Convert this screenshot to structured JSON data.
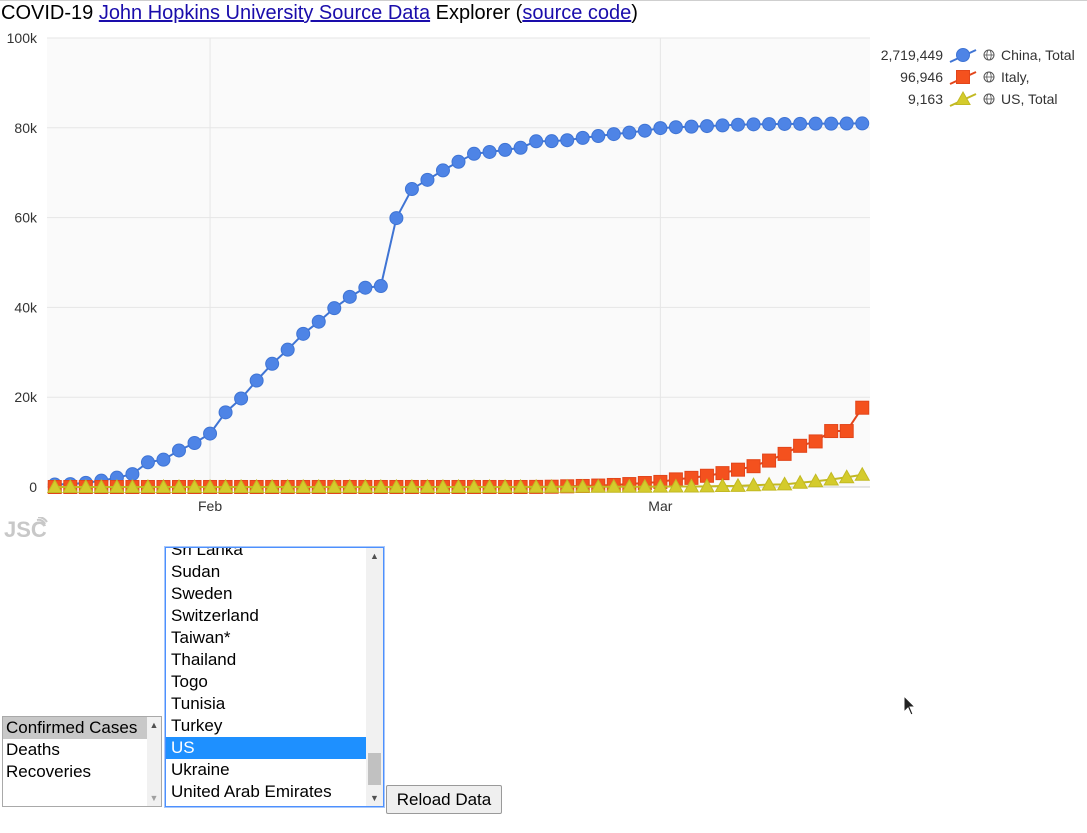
{
  "page": {
    "title_prefix": "COVID-19 ",
    "source_link": "John Hopkins University Source Data",
    "title_middle": " Explorer (",
    "code_link": "source code",
    "title_suffix": ")"
  },
  "chart_data": {
    "type": "line",
    "title": "",
    "xlabel": "",
    "ylabel": "",
    "x_start": "2020-01-22",
    "x_end": "2020-03-14",
    "x_ticks": [
      {
        "date": "2020-02-01",
        "label": "Feb"
      },
      {
        "date": "2020-03-01",
        "label": "Mar"
      }
    ],
    "y_ticks": [
      {
        "value": 0,
        "label": "0"
      },
      {
        "value": 20000,
        "label": "20k"
      },
      {
        "value": 40000,
        "label": "40k"
      },
      {
        "value": 60000,
        "label": "60k"
      },
      {
        "value": 80000,
        "label": "80k"
      },
      {
        "value": 100000,
        "label": "100k"
      }
    ],
    "ylim": [
      0,
      100000
    ],
    "grid": true,
    "legend_position": "top-right",
    "series": [
      {
        "name": "China, Total",
        "legend_value": "2,719,449",
        "color": "#4e84e6",
        "stroke": "#3f74d4",
        "marker": "circle",
        "values": [
          548,
          643,
          920,
          1406,
          2075,
          2877,
          5509,
          6087,
          8141,
          9802,
          11891,
          16630,
          19716,
          23707,
          27440,
          30587,
          34110,
          36814,
          39829,
          42354,
          44386,
          44759,
          59895,
          66358,
          68413,
          70513,
          72434,
          74211,
          74619,
          75077,
          75550,
          77001,
          77022,
          77241,
          77754,
          78166,
          78600,
          78928,
          79356,
          79932,
          80136,
          80261,
          80386,
          80537,
          80690,
          80770,
          80823,
          80860,
          80887,
          80921,
          80932,
          80945,
          80977
        ]
      },
      {
        "name": "Italy,",
        "legend_value": "96,946",
        "color": "#f4511e",
        "stroke": "#e2451a",
        "marker": "square",
        "values": [
          0,
          0,
          0,
          0,
          0,
          0,
          0,
          0,
          0,
          2,
          2,
          2,
          2,
          2,
          2,
          2,
          3,
          3,
          3,
          3,
          3,
          3,
          3,
          3,
          3,
          3,
          3,
          3,
          3,
          3,
          3,
          20,
          62,
          155,
          229,
          322,
          453,
          655,
          888,
          1128,
          1694,
          2036,
          2502,
          3089,
          3858,
          4636,
          5883,
          7375,
          9172,
          10149,
          12462,
          12462,
          17660
        ]
      },
      {
        "name": "US, Total",
        "legend_value": "9,163",
        "color": "#d4cb2c",
        "stroke": "#c2b923",
        "marker": "triangle",
        "values": [
          1,
          1,
          2,
          2,
          5,
          5,
          5,
          5,
          5,
          7,
          8,
          8,
          11,
          11,
          11,
          11,
          11,
          11,
          11,
          11,
          12,
          12,
          13,
          13,
          13,
          13,
          13,
          13,
          13,
          13,
          15,
          15,
          15,
          51,
          51,
          57,
          58,
          60,
          68,
          74,
          98,
          118,
          149,
          217,
          262,
          402,
          518,
          583,
          959,
          1281,
          1663,
          2179,
          2727
        ]
      }
    ]
  },
  "logo": {
    "name": "JSC"
  },
  "metric_list": {
    "options": [
      "Confirmed Cases",
      "Deaths",
      "Recoveries"
    ],
    "selected": "Confirmed Cases"
  },
  "country_list": {
    "options": [
      "Sri Lanka",
      "Sudan",
      "Sweden",
      "Switzerland",
      "Taiwan*",
      "Thailand",
      "Togo",
      "Tunisia",
      "Turkey",
      "US",
      "Ukraine",
      "United Arab Emirates"
    ],
    "selected": "US"
  },
  "reload": {
    "label": "Reload Data"
  },
  "icons": {
    "scroll_up": "scroll-up-arrow-icon",
    "scroll_down": "scroll-down-arrow-icon",
    "legend_globe": "globe-icon"
  }
}
